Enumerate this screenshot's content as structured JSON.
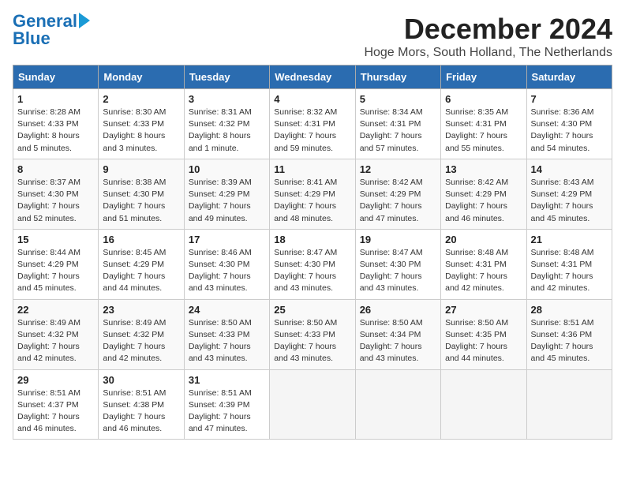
{
  "logo": {
    "line1": "General",
    "line2": "Blue"
  },
  "title": "December 2024",
  "subtitle": "Hoge Mors, South Holland, The Netherlands",
  "weekdays": [
    "Sunday",
    "Monday",
    "Tuesday",
    "Wednesday",
    "Thursday",
    "Friday",
    "Saturday"
  ],
  "weeks": [
    [
      {
        "day": 1,
        "sunrise": "8:28 AM",
        "sunset": "4:33 PM",
        "daylight": "8 hours and 5 minutes."
      },
      {
        "day": 2,
        "sunrise": "8:30 AM",
        "sunset": "4:33 PM",
        "daylight": "8 hours and 3 minutes."
      },
      {
        "day": 3,
        "sunrise": "8:31 AM",
        "sunset": "4:32 PM",
        "daylight": "8 hours and 1 minute."
      },
      {
        "day": 4,
        "sunrise": "8:32 AM",
        "sunset": "4:31 PM",
        "daylight": "7 hours and 59 minutes."
      },
      {
        "day": 5,
        "sunrise": "8:34 AM",
        "sunset": "4:31 PM",
        "daylight": "7 hours and 57 minutes."
      },
      {
        "day": 6,
        "sunrise": "8:35 AM",
        "sunset": "4:31 PM",
        "daylight": "7 hours and 55 minutes."
      },
      {
        "day": 7,
        "sunrise": "8:36 AM",
        "sunset": "4:30 PM",
        "daylight": "7 hours and 54 minutes."
      }
    ],
    [
      {
        "day": 8,
        "sunrise": "8:37 AM",
        "sunset": "4:30 PM",
        "daylight": "7 hours and 52 minutes."
      },
      {
        "day": 9,
        "sunrise": "8:38 AM",
        "sunset": "4:30 PM",
        "daylight": "7 hours and 51 minutes."
      },
      {
        "day": 10,
        "sunrise": "8:39 AM",
        "sunset": "4:29 PM",
        "daylight": "7 hours and 49 minutes."
      },
      {
        "day": 11,
        "sunrise": "8:41 AM",
        "sunset": "4:29 PM",
        "daylight": "7 hours and 48 minutes."
      },
      {
        "day": 12,
        "sunrise": "8:42 AM",
        "sunset": "4:29 PM",
        "daylight": "7 hours and 47 minutes."
      },
      {
        "day": 13,
        "sunrise": "8:42 AM",
        "sunset": "4:29 PM",
        "daylight": "7 hours and 46 minutes."
      },
      {
        "day": 14,
        "sunrise": "8:43 AM",
        "sunset": "4:29 PM",
        "daylight": "7 hours and 45 minutes."
      }
    ],
    [
      {
        "day": 15,
        "sunrise": "8:44 AM",
        "sunset": "4:29 PM",
        "daylight": "7 hours and 45 minutes."
      },
      {
        "day": 16,
        "sunrise": "8:45 AM",
        "sunset": "4:29 PM",
        "daylight": "7 hours and 44 minutes."
      },
      {
        "day": 17,
        "sunrise": "8:46 AM",
        "sunset": "4:30 PM",
        "daylight": "7 hours and 43 minutes."
      },
      {
        "day": 18,
        "sunrise": "8:47 AM",
        "sunset": "4:30 PM",
        "daylight": "7 hours and 43 minutes."
      },
      {
        "day": 19,
        "sunrise": "8:47 AM",
        "sunset": "4:30 PM",
        "daylight": "7 hours and 43 minutes."
      },
      {
        "day": 20,
        "sunrise": "8:48 AM",
        "sunset": "4:31 PM",
        "daylight": "7 hours and 42 minutes."
      },
      {
        "day": 21,
        "sunrise": "8:48 AM",
        "sunset": "4:31 PM",
        "daylight": "7 hours and 42 minutes."
      }
    ],
    [
      {
        "day": 22,
        "sunrise": "8:49 AM",
        "sunset": "4:32 PM",
        "daylight": "7 hours and 42 minutes."
      },
      {
        "day": 23,
        "sunrise": "8:49 AM",
        "sunset": "4:32 PM",
        "daylight": "7 hours and 42 minutes."
      },
      {
        "day": 24,
        "sunrise": "8:50 AM",
        "sunset": "4:33 PM",
        "daylight": "7 hours and 43 minutes."
      },
      {
        "day": 25,
        "sunrise": "8:50 AM",
        "sunset": "4:33 PM",
        "daylight": "7 hours and 43 minutes."
      },
      {
        "day": 26,
        "sunrise": "8:50 AM",
        "sunset": "4:34 PM",
        "daylight": "7 hours and 43 minutes."
      },
      {
        "day": 27,
        "sunrise": "8:50 AM",
        "sunset": "4:35 PM",
        "daylight": "7 hours and 44 minutes."
      },
      {
        "day": 28,
        "sunrise": "8:51 AM",
        "sunset": "4:36 PM",
        "daylight": "7 hours and 45 minutes."
      }
    ],
    [
      {
        "day": 29,
        "sunrise": "8:51 AM",
        "sunset": "4:37 PM",
        "daylight": "7 hours and 46 minutes."
      },
      {
        "day": 30,
        "sunrise": "8:51 AM",
        "sunset": "4:38 PM",
        "daylight": "7 hours and 46 minutes."
      },
      {
        "day": 31,
        "sunrise": "8:51 AM",
        "sunset": "4:39 PM",
        "daylight": "7 hours and 47 minutes."
      },
      null,
      null,
      null,
      null
    ]
  ]
}
